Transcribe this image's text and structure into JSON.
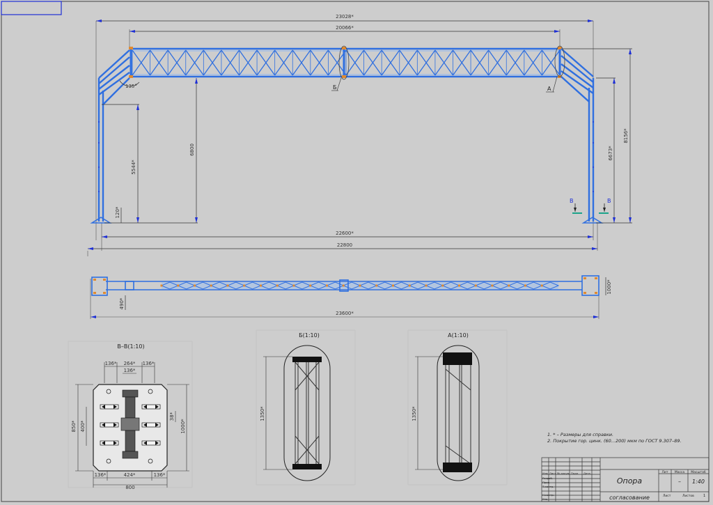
{
  "drawing": {
    "main_dims": {
      "overall_top": "23028*",
      "truss_length": "20066*",
      "span_bottom": "22600*",
      "overall_bottom": "22800",
      "plan_length": "23600*",
      "angle": "135°",
      "h_left_inner": "5544*",
      "h_left_outer": "6800",
      "h_right_inner": "6673*",
      "h_right_outer": "8156*",
      "base_small": "120*",
      "plan_width": "1000*",
      "plan_offset": "490*"
    },
    "callouts": {
      "b_ref": "Б",
      "a_ref": "А",
      "section_left": "В",
      "section_right": "В"
    },
    "views": {
      "section_vv": {
        "title": "В–В(1:10)",
        "d_top1": "136*",
        "d_top2": "264*",
        "d_top3": "136*",
        "d_top_inner": "136*",
        "d_bot1": "136*",
        "d_bot2": "424*",
        "d_bot3": "136*",
        "d_width": "800",
        "d_left_outer": "850*",
        "d_left_inner": "400*",
        "d_right_small": "38*",
        "d_right_outer": "1000*"
      },
      "detail_b": {
        "title": "Б(1:10)",
        "d_height": "1350*"
      },
      "detail_a": {
        "title": "А(1:10)",
        "d_height": "1350*"
      }
    },
    "notes": {
      "line1": "1. * – Размеры для справки.",
      "line2": "2. Покрытие гор. цинк. (60...200) мкм по ГОСТ 9.307–89."
    },
    "title_block": {
      "name": "Опора",
      "subtitle": "согласование",
      "col_lit": "Лит",
      "col_mass": "Масса",
      "col_scale": "Масштаб",
      "mass_value": "–",
      "scale_value": "1:40",
      "sheet_label": "Лист",
      "sheets_label": "Листов",
      "sheets_value": "1",
      "row_izm": "Изм",
      "row_list": "Лист",
      "row_doc": "№ докум.",
      "row_sign": "Подп.",
      "row_date": "Дата",
      "role_dev": "Разраб.",
      "role_check": "Пров.",
      "role_tcontrol": "Т.контр.",
      "role_ncontrol": "Н.контр.",
      "role_approve": "Утв."
    }
  }
}
